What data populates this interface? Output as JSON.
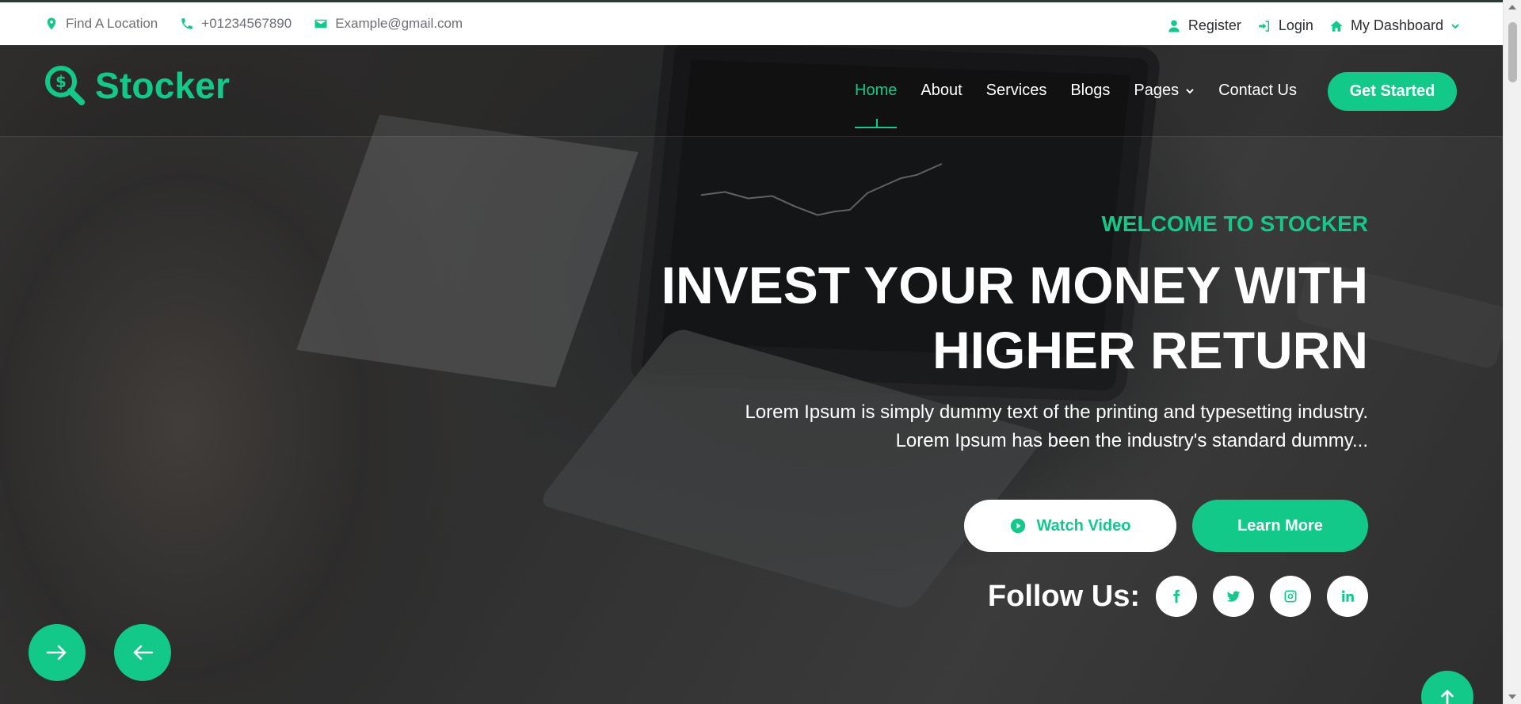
{
  "topbar": {
    "location": "Find A Location",
    "phone": "+01234567890",
    "email": "Example@gmail.com",
    "register": "Register",
    "login": "Login",
    "dashboard": "My Dashboard"
  },
  "brand": {
    "name": "Stocker",
    "accent": "#12c98a"
  },
  "nav": {
    "items": [
      "Home",
      "About",
      "Services",
      "Blogs",
      "Pages",
      "Contact Us"
    ],
    "active": "Home",
    "cta": "Get Started"
  },
  "hero": {
    "eyebrow": "WELCOME TO STOCKER",
    "headline_line1": "INVEST YOUR MONEY WITH",
    "headline_line2": "HIGHER RETURN",
    "desc_line1": "Lorem Ipsum is simply dummy text of the printing and typesetting industry.",
    "desc_line2": "Lorem Ipsum has been the industry's standard dummy...",
    "watch_video": "Watch Video",
    "learn_more": "Learn More",
    "follow_label": "Follow Us:",
    "social_icons": [
      "facebook-icon",
      "twitter-icon",
      "instagram-icon",
      "linkedin-icon"
    ]
  }
}
